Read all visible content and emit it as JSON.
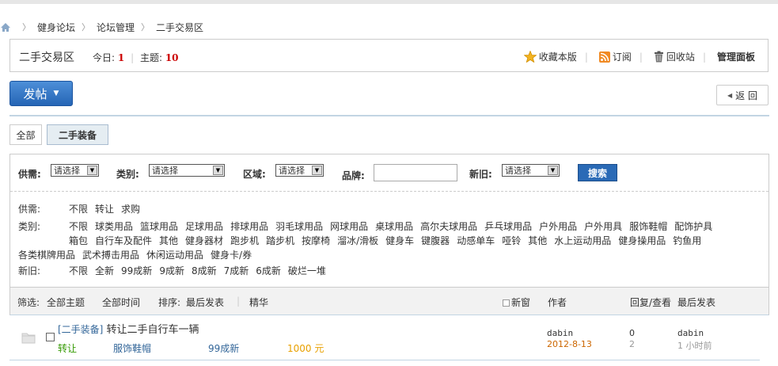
{
  "breadcrumb": [
    "健身论坛",
    "论坛管理",
    "二手交易区"
  ],
  "forum": {
    "title": "二手交易区",
    "today_label": "今日:",
    "today_count": "1",
    "topics_label": "主题:",
    "topics_count": "10",
    "favorite": "收藏本版",
    "subscribe": "订阅",
    "recycle": "回收站",
    "admin_panel": "管理面板"
  },
  "post_button": "发帖",
  "back_button": "返 回",
  "tabs": [
    "全部",
    "二手装备"
  ],
  "search": {
    "supply_label": "供需:",
    "type_label": "类别:",
    "region_label": "区域:",
    "brand_label": "品牌:",
    "condition_label": "新旧:",
    "placeholder_select": "请选择",
    "search_button": "搜索"
  },
  "facets": {
    "supply": {
      "label": "供需:",
      "options": [
        "不限",
        "转让",
        "求购"
      ]
    },
    "category": {
      "label": "类别:",
      "line1": [
        "不限",
        "球类用品",
        "篮球用品",
        "足球用品",
        "排球用品",
        "羽毛球用品",
        "网球用品",
        "桌球用品",
        "高尔夫球用品",
        "乒乓球用品",
        "户外用品",
        "户外用具",
        "服饰鞋帽",
        "配饰护具"
      ],
      "line2": [
        "箱包",
        "自行车及配件",
        "其他",
        "健身器材",
        "跑步机",
        "踏步机",
        "按摩椅",
        "溜冰/滑板",
        "健身车",
        "键腹器",
        "动感单车",
        "哑铃",
        "其他",
        "水上运动用品",
        "健身操用品",
        "钓鱼用"
      ],
      "line3": [
        "各类棋牌用品",
        "武术搏击用品",
        "休闲运动用品",
        "健身卡/券"
      ]
    },
    "condition": {
      "label": "新旧:",
      "options": [
        "不限",
        "全新",
        "99成新",
        "9成新",
        "8成新",
        "7成新",
        "6成新",
        "破烂一堆"
      ]
    }
  },
  "sortbar": {
    "filter_label": "筛选:",
    "all_topics": "全部主题",
    "all_time": "全部时间",
    "sort_label": "排序:",
    "last_post": "最后发表",
    "digest": "精华",
    "new_window": "新窗",
    "author": "作者",
    "replies_views": "回复/查看",
    "last_reply": "最后发表"
  },
  "threads": [
    {
      "tag": "[二手装备]",
      "title": "转让二手自行车一辆",
      "supply": "转让",
      "category": "服饰鞋帽",
      "condition": "99成新",
      "price": "1000 元",
      "author": "dabin",
      "date": "2012-8-13",
      "replies": "0",
      "views": "2",
      "last_user": "dabin",
      "last_time": "1 小时前"
    }
  ],
  "colors": {
    "accent": "#2565b5",
    "highlight": "#c00",
    "date": "#c60",
    "price": "#e8a000",
    "green_link": "#390"
  }
}
